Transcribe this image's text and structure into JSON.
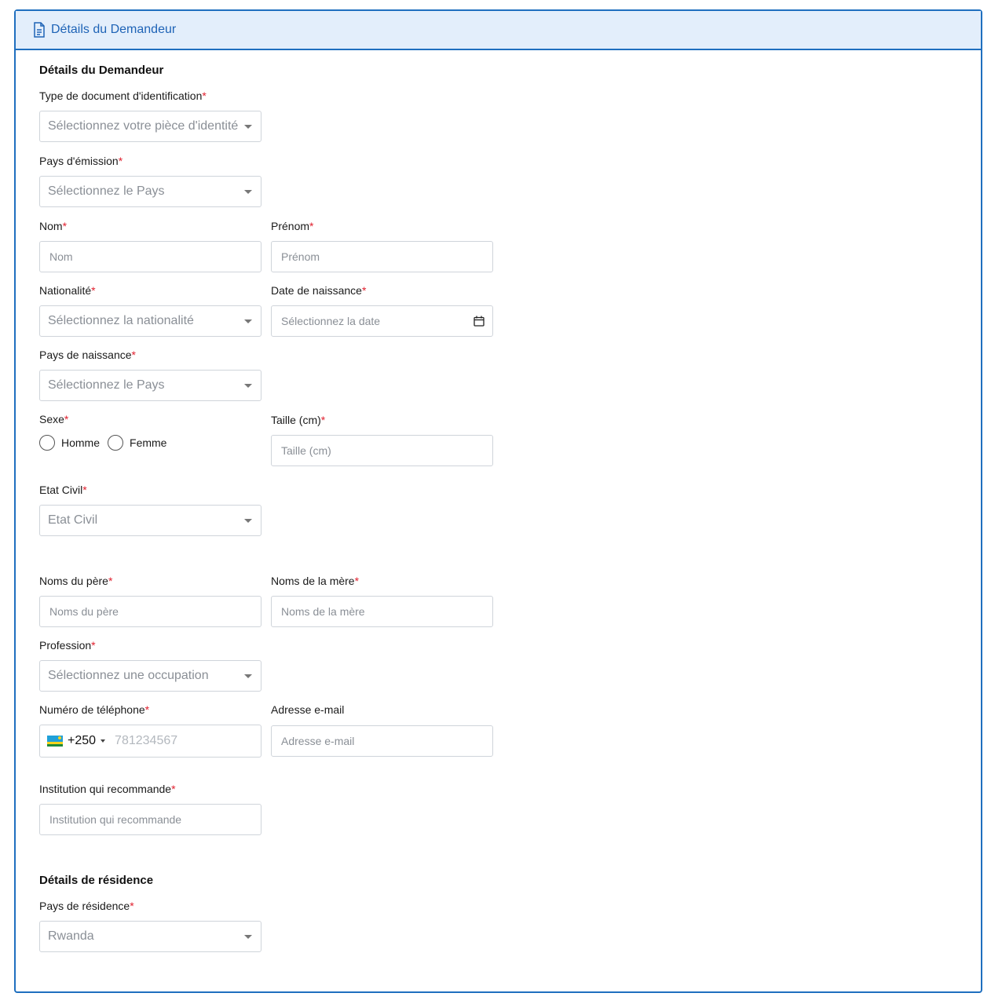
{
  "header": {
    "title": "Détails du Demandeur",
    "icon": "document-icon"
  },
  "section_applicant": {
    "title": "Détails du Demandeur"
  },
  "required_marker": "*",
  "fields": {
    "id_type": {
      "label": "Type de document d'identification",
      "placeholder": "Sélectionnez votre pièce d'identité"
    },
    "issue_country": {
      "label": "Pays d'émission",
      "placeholder": "Sélectionnez le Pays"
    },
    "last_name": {
      "label": "Nom",
      "placeholder": "Nom"
    },
    "first_name": {
      "label": "Prénom",
      "placeholder": "Prénom"
    },
    "nationality": {
      "label": "Nationalité",
      "placeholder": "Sélectionnez la nationalité"
    },
    "birth_date": {
      "label": "Date de naissance",
      "placeholder": "Sélectionnez la date"
    },
    "birth_country": {
      "label": "Pays de naissance",
      "placeholder": "Sélectionnez le Pays"
    },
    "sex": {
      "label": "Sexe",
      "options": [
        "Homme",
        "Femme"
      ]
    },
    "height": {
      "label": "Taille (cm)",
      "placeholder": "Taille (cm)"
    },
    "civil_status": {
      "label": "Etat Civil",
      "placeholder": "Etat Civil"
    },
    "father_names": {
      "label": "Noms du père",
      "placeholder": "Noms du père"
    },
    "mother_names": {
      "label": "Noms de la mère",
      "placeholder": "Noms de la mère"
    },
    "profession": {
      "label": "Profession",
      "placeholder": "Sélectionnez une occupation"
    },
    "phone": {
      "label": "Numéro de téléphone",
      "country_code": "+250",
      "placeholder": "781234567"
    },
    "email": {
      "label": "Adresse e-mail",
      "placeholder": "Adresse e-mail"
    },
    "recommending_institution": {
      "label": "Institution qui recommande",
      "placeholder": "Institution qui recommande"
    }
  },
  "section_residence": {
    "title": "Détails de résidence"
  },
  "residence": {
    "country": {
      "label": "Pays de résidence",
      "value": "Rwanda"
    }
  },
  "colors": {
    "accent": "#1f6fbf",
    "header_bg": "#e3eefb",
    "required": "#e0202e"
  }
}
